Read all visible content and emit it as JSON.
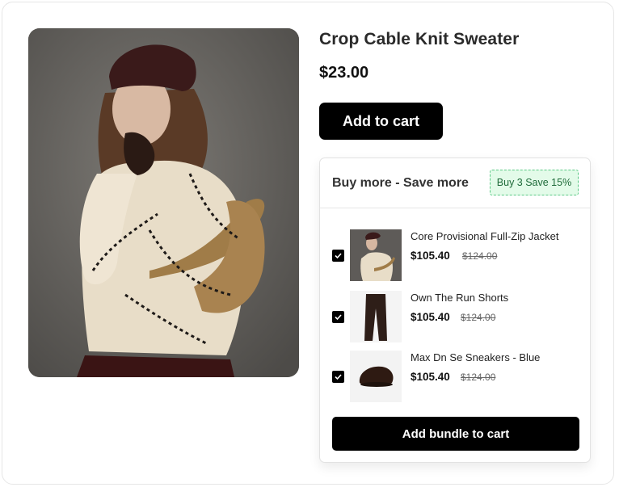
{
  "product": {
    "title": "Crop Cable Knit Sweater",
    "price": "$23.00",
    "add_to_cart_label": "Add to cart",
    "image_name": "product-photo"
  },
  "bundle": {
    "title": "Buy more - Save more",
    "badge": "Buy 3 Save 15%",
    "button_label": "Add bundle to cart",
    "items": [
      {
        "name": "Core Provisional Full-Zip Jacket",
        "price": "$105.40",
        "old_price": "$124.00",
        "checked": true,
        "thumb": "sweater-thumb"
      },
      {
        "name": "Own The Run Shorts",
        "price": "$105.40",
        "old_price": "$124.00",
        "checked": true,
        "thumb": "pants-thumb"
      },
      {
        "name": "Max Dn Se Sneakers - Blue",
        "price": "$105.40",
        "old_price": "$124.00",
        "checked": true,
        "thumb": "beret-thumb"
      }
    ]
  },
  "colors": {
    "accent": "#000000",
    "badge_bg": "#e3fbe9",
    "badge_border": "#5bc985",
    "badge_text": "#1f6b3a"
  }
}
